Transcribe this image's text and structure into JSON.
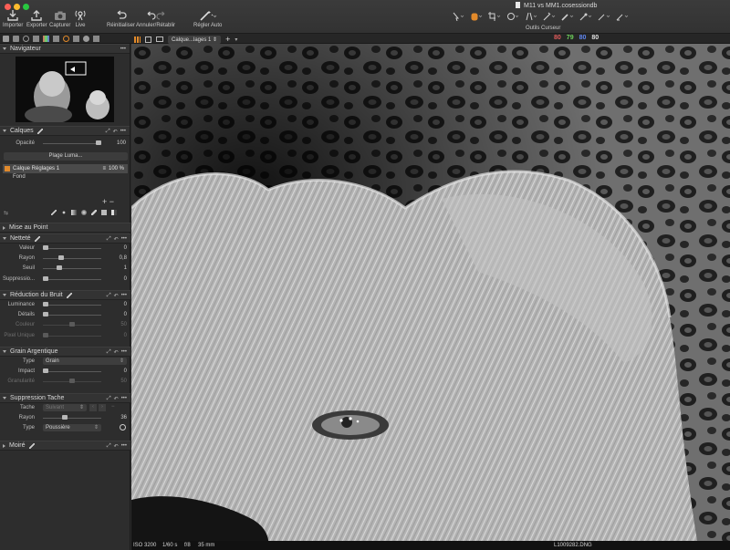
{
  "window": {
    "title": "M11 vs MM1.cosessiondb"
  },
  "toolbar": {
    "left_buttons": [
      {
        "label": "Importer",
        "icon": "download-tray-icon"
      },
      {
        "label": "Exporter",
        "icon": "upload-tray-icon"
      },
      {
        "label": "Capturer",
        "icon": "camera-icon"
      },
      {
        "label": "Live",
        "icon": "live-share-icon"
      }
    ],
    "reset_label": "Réinitialiser",
    "undo_redo_label": "Annuler/Rétablir",
    "auto_adjust_label": "Régler Auto",
    "cursor_tools_label": "Outils Curseur",
    "accent_color": "#e28a2a"
  },
  "viewer_bar": {
    "variant_tab": "Calque...lages 1",
    "add_label": "+",
    "readout": [
      {
        "value": "80",
        "color": "#e35b5b"
      },
      {
        "value": "79",
        "color": "#6fd35c"
      },
      {
        "value": "80",
        "color": "#5f86f0"
      },
      {
        "value": "80",
        "color": "#e0e0e0"
      }
    ]
  },
  "navigator": {
    "title": "Navigateur"
  },
  "layers": {
    "title": "Calques",
    "opacity_label": "Opacité",
    "opacity_value": "100",
    "opacity_level": 1.0,
    "luma_button": "Plage Luma...",
    "selected_layer": "Calque Réglages 1",
    "selected_layer_opacity": "100 %",
    "background_layer": "Fond",
    "add_remove": "+ −"
  },
  "focus": {
    "title": "Mise au Point"
  },
  "sharpness": {
    "title": "Netteté",
    "rows": [
      {
        "label": "Valeur",
        "value": "0",
        "level": 0.0
      },
      {
        "label": "Rayon",
        "value": "0,8",
        "level": 0.3
      },
      {
        "label": "Seuil",
        "value": "1",
        "level": 0.25
      },
      {
        "label": "Suppressio...",
        "value": "0",
        "level": 0.0
      }
    ]
  },
  "noise": {
    "title": "Réduction du Bruit",
    "rows": [
      {
        "label": "Luminance",
        "value": "0",
        "level": 0.0,
        "dim": false
      },
      {
        "label": "Détails",
        "value": "0",
        "level": 0.0,
        "dim": false
      },
      {
        "label": "Couleur",
        "value": "50",
        "level": 0.5,
        "dim": true
      },
      {
        "label": "Pixel Unique",
        "value": "0",
        "level": 0.0,
        "dim": true
      }
    ]
  },
  "grain": {
    "title": "Grain Argentique",
    "type_label": "Type",
    "type_value": "Grain",
    "impact_label": "Impact",
    "impact_value": "0",
    "impact_level": 0.0,
    "granularity_label": "Granularité",
    "granularity_value": "50",
    "granularity_level": 0.5
  },
  "spot": {
    "title": "Suppression Tache",
    "spot_label": "Tache",
    "spot_value": "Suivant",
    "radius_label": "Rayon",
    "radius_value": "36",
    "radius_level": 0.36,
    "type_label": "Type",
    "type_value": "Poussière"
  },
  "moire": {
    "title": "Moiré"
  },
  "status": {
    "iso": "ISO 3200",
    "shutter": "1/60 s",
    "aperture": "f/8",
    "focal": "35 mm",
    "filename": "L1009282.DNG"
  }
}
